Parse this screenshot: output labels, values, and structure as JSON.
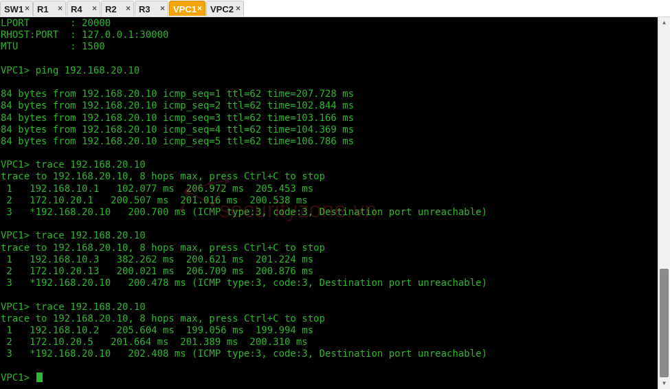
{
  "tabs": [
    {
      "label": "SW1",
      "active": false
    },
    {
      "label": "R1",
      "active": false
    },
    {
      "label": "R4",
      "active": false
    },
    {
      "label": "R2",
      "active": false
    },
    {
      "label": "R3",
      "active": false
    },
    {
      "label": "VPC1",
      "active": true
    },
    {
      "label": "VPC2",
      "active": false
    }
  ],
  "tab_close_glyph": "×",
  "colors": {
    "terminal_text": "#2fb52f",
    "terminal_bg": "#000000",
    "active_tab": "#f5a40a"
  },
  "watermark": {
    "text": "securityzone.vn"
  },
  "terminal": {
    "lines": [
      "LPORT       : 20000",
      "RHOST:PORT  : 127.0.0.1:30000",
      "MTU         : 1500",
      "",
      "VPC1> ping 192.168.20.10",
      "",
      "84 bytes from 192.168.20.10 icmp_seq=1 ttl=62 time=207.728 ms",
      "84 bytes from 192.168.20.10 icmp_seq=2 ttl=62 time=102.844 ms",
      "84 bytes from 192.168.20.10 icmp_seq=3 ttl=62 time=103.166 ms",
      "84 bytes from 192.168.20.10 icmp_seq=4 ttl=62 time=104.369 ms",
      "84 bytes from 192.168.20.10 icmp_seq=5 ttl=62 time=106.786 ms",
      "",
      "VPC1> trace 192.168.20.10",
      "trace to 192.168.20.10, 8 hops max, press Ctrl+C to stop",
      " 1   192.168.10.1   102.077 ms  206.972 ms  205.453 ms",
      " 2   172.10.20.1   200.507 ms  201.016 ms  200.538 ms",
      " 3   *192.168.20.10   200.700 ms (ICMP type:3, code:3, Destination port unreachable)",
      "",
      "VPC1> trace 192.168.20.10",
      "trace to 192.168.20.10, 8 hops max, press Ctrl+C to stop",
      " 1   192.168.10.3   382.262 ms  200.621 ms  201.224 ms",
      " 2   172.10.20.13   200.021 ms  206.709 ms  200.876 ms",
      " 3   *192.168.20.10   200.478 ms (ICMP type:3, code:3, Destination port unreachable)",
      "",
      "VPC1> trace 192.168.20.10",
      "trace to 192.168.20.10, 8 hops max, press Ctrl+C to stop",
      " 1   192.168.10.2   205.604 ms  199.056 ms  199.994 ms",
      " 2   172.10.20.5   201.664 ms  201.389 ms  200.310 ms",
      " 3   *192.168.20.10   202.408 ms (ICMP type:3, code:3, Destination port unreachable)",
      ""
    ],
    "prompt": "VPC1> "
  }
}
